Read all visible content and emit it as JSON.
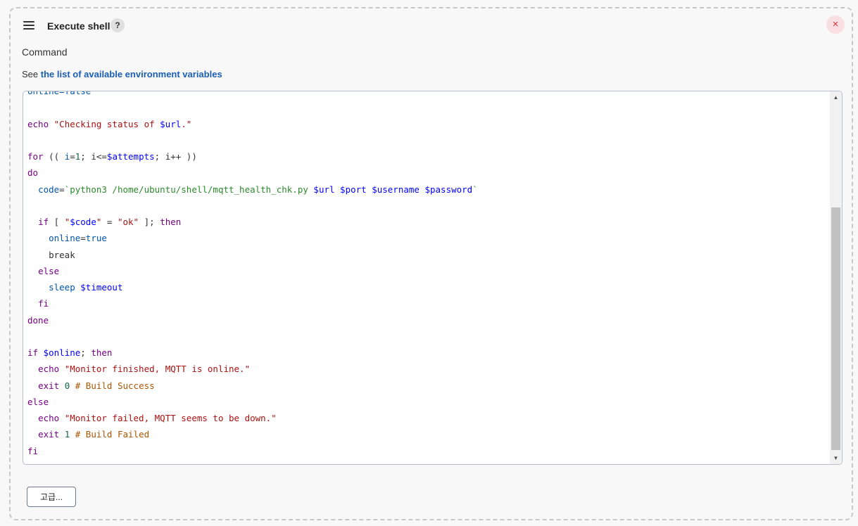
{
  "step": {
    "title": "Execute shell",
    "help_label": "?",
    "close_label": "×"
  },
  "command": {
    "label": "Command",
    "env_prefix": "See ",
    "env_link": "the list of available environment variables"
  },
  "code_lines": [
    [
      {
        "t": "online=false",
        "c": "var"
      }
    ],
    [],
    [
      {
        "t": "echo ",
        "c": "kw"
      },
      {
        "t": "\"Checking status of ",
        "c": "str"
      },
      {
        "t": "$url",
        "c": "prop"
      },
      {
        "t": ".\"",
        "c": "str"
      }
    ],
    [],
    [
      {
        "t": "for",
        "c": "kw"
      },
      {
        "t": " (( ",
        "c": ""
      },
      {
        "t": "i",
        "c": "var"
      },
      {
        "t": "=",
        "c": ""
      },
      {
        "t": "1",
        "c": "num"
      },
      {
        "t": "; i<=",
        "c": ""
      },
      {
        "t": "$attempts",
        "c": "prop"
      },
      {
        "t": "; i++ ))",
        "c": ""
      }
    ],
    [
      {
        "t": "do",
        "c": "kw"
      }
    ],
    [
      {
        "t": "  ",
        "c": ""
      },
      {
        "t": "code",
        "c": "var"
      },
      {
        "t": "=",
        "c": ""
      },
      {
        "t": "`python3 /home/ubuntu/shell/mqtt_health_chk.py ",
        "c": "bq"
      },
      {
        "t": "$url $port $username $password",
        "c": "prop"
      },
      {
        "t": "`",
        "c": "bq"
      }
    ],
    [],
    [
      {
        "t": "  ",
        "c": ""
      },
      {
        "t": "if",
        "c": "kw"
      },
      {
        "t": " [ ",
        "c": ""
      },
      {
        "t": "\"",
        "c": "str"
      },
      {
        "t": "$code",
        "c": "prop"
      },
      {
        "t": "\"",
        "c": "str"
      },
      {
        "t": " = ",
        "c": ""
      },
      {
        "t": "\"ok\"",
        "c": "str"
      },
      {
        "t": " ]; ",
        "c": ""
      },
      {
        "t": "then",
        "c": "kw"
      }
    ],
    [
      {
        "t": "    ",
        "c": ""
      },
      {
        "t": "online",
        "c": "var"
      },
      {
        "t": "=",
        "c": ""
      },
      {
        "t": "true",
        "c": "var"
      }
    ],
    [
      {
        "t": "    break",
        "c": ""
      }
    ],
    [
      {
        "t": "  ",
        "c": ""
      },
      {
        "t": "else",
        "c": "kw"
      }
    ],
    [
      {
        "t": "    ",
        "c": ""
      },
      {
        "t": "sleep ",
        "c": "var"
      },
      {
        "t": "$timeout",
        "c": "prop"
      }
    ],
    [
      {
        "t": "  ",
        "c": ""
      },
      {
        "t": "fi",
        "c": "kw"
      }
    ],
    [
      {
        "t": "done",
        "c": "kw"
      }
    ],
    [],
    [
      {
        "t": "if",
        "c": "kw"
      },
      {
        "t": " ",
        "c": ""
      },
      {
        "t": "$online",
        "c": "prop"
      },
      {
        "t": "; ",
        "c": ""
      },
      {
        "t": "then",
        "c": "kw"
      }
    ],
    [
      {
        "t": "  ",
        "c": ""
      },
      {
        "t": "echo ",
        "c": "kw"
      },
      {
        "t": "\"Monitor finished, MQTT is online.\"",
        "c": "str"
      }
    ],
    [
      {
        "t": "  ",
        "c": ""
      },
      {
        "t": "exit ",
        "c": "kw"
      },
      {
        "t": "0",
        "c": "num"
      },
      {
        "t": " # Build Success",
        "c": "cmt"
      }
    ],
    [
      {
        "t": "else",
        "c": "kw"
      }
    ],
    [
      {
        "t": "  ",
        "c": ""
      },
      {
        "t": "echo ",
        "c": "kw"
      },
      {
        "t": "\"Monitor failed, MQTT seems to be down.\"",
        "c": "str"
      }
    ],
    [
      {
        "t": "  ",
        "c": ""
      },
      {
        "t": "exit ",
        "c": "kw"
      },
      {
        "t": "1",
        "c": "num"
      },
      {
        "t": " # Build Failed",
        "c": "cmt"
      }
    ],
    [
      {
        "t": "fi",
        "c": "kw"
      }
    ]
  ],
  "scrollbar": {
    "up_icon": "scroll-up-arrow",
    "down_icon": "scroll-down-arrow"
  },
  "buttons": {
    "advanced_label": "고급..."
  },
  "colors": {
    "keyword": "#770088",
    "string": "#aa1111",
    "variable": "#0055aa",
    "close_accent": "#d0303e",
    "link": "#1a5fb4"
  }
}
